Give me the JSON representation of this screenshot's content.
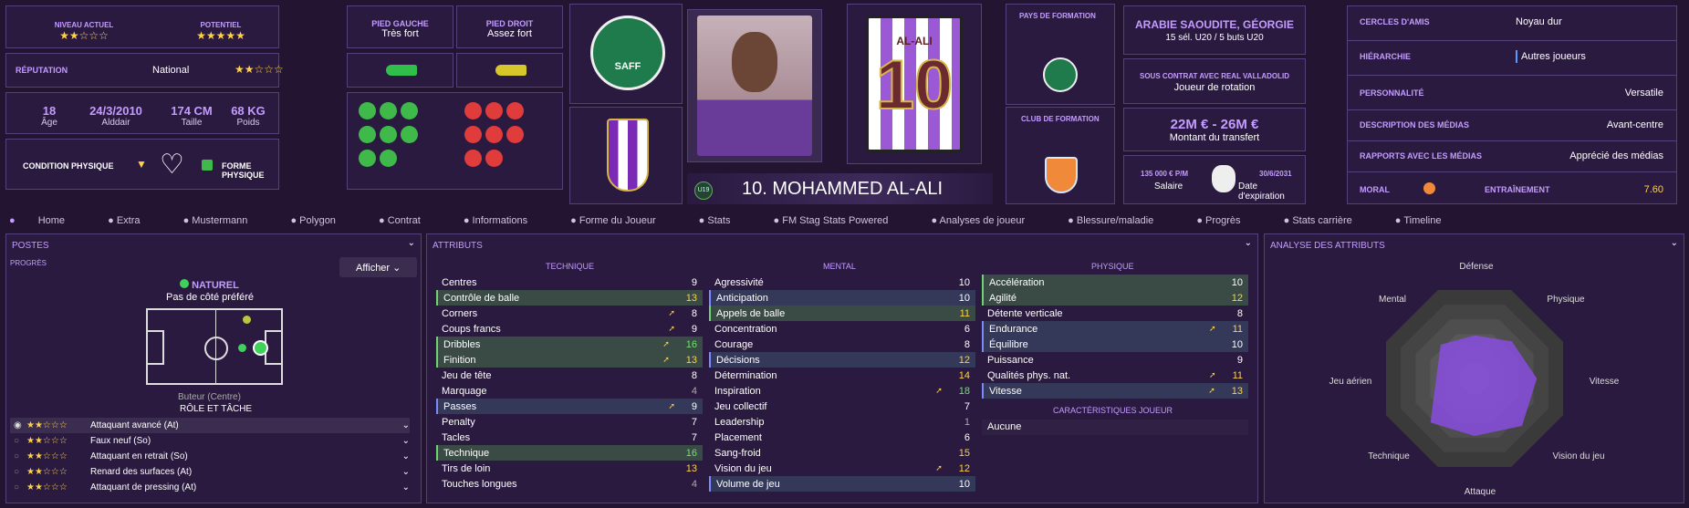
{
  "ratings": {
    "current_label": "NIVEAU ACTUEL",
    "current_stars": "★★☆☆☆",
    "potential_label": "POTENTIEL",
    "potential_stars": "★★★★★"
  },
  "reputation": {
    "label": "RÉPUTATION",
    "value": "National",
    "stars": "★★☆☆☆"
  },
  "bio": {
    "age": "18",
    "age_label": "Âge",
    "dob": "24/3/2010",
    "club_label": "Alddair",
    "height": "174 CM",
    "height_label": "Taille",
    "weight": "68 KG",
    "weight_label": "Poids"
  },
  "fitness": {
    "condition_label": "CONDITION PHYSIQUE",
    "form_label": "FORME PHYSIQUE"
  },
  "feet": {
    "left_label": "PIED GAUCHE",
    "left_value": "Très fort",
    "right_label": "PIED DROIT",
    "right_value": "Assez fort"
  },
  "formation": {
    "country_label": "PAYS DE FORMATION",
    "club_label": "CLUB DE FORMATION"
  },
  "nation": {
    "name": "ARABIE SAOUDITE, GÉORGIE",
    "caps": "15 sél. U20 / 5 buts U20"
  },
  "contract": {
    "label": "SOUS CONTRAT AVEC REAL VALLADOLID",
    "role": "Joueur de rotation",
    "value": "22M € - 26M €",
    "value_label": "Montant du transfert",
    "wage": "135 000 € P/M",
    "wage_label": "Salaire",
    "expiry": "30/6/2031",
    "expiry_label": "Date d'expiration"
  },
  "player": {
    "name": "10. MOHAMMED AL-ALI",
    "age_badge": "U19",
    "shirt_name": "AL-ALI",
    "shirt_number": "10",
    "saff": "SAFF"
  },
  "social": [
    {
      "label": "CERCLES D'AMIS",
      "value": "Noyau dur"
    },
    {
      "label": "HIÉRARCHIE",
      "value": "Autres joueurs"
    },
    {
      "label": "PERSONNALITÉ",
      "value": "Versatile"
    },
    {
      "label": "DESCRIPTION DES MÉDIAS",
      "value": "Avant-centre"
    },
    {
      "label": "RAPPORTS AVEC LES MÉDIAS",
      "value": "Apprécié des médias"
    }
  ],
  "morale": {
    "label": "MORAL",
    "training_label": "ENTRAÎNEMENT",
    "training_value": "7.60"
  },
  "tabs": [
    "Home",
    "Extra",
    "Mustermann",
    "Polygon",
    "Contrat",
    "Informations",
    "Forme du Joueur",
    "Stats",
    "FM Stag Stats Powered",
    "Analyses de joueur",
    "Blessure/maladie",
    "Progrès",
    "Stats carrière",
    "Timeline"
  ],
  "positions": {
    "title": "POSTES",
    "progress": "PROGRÈS",
    "show_button": "Afficher",
    "natural": "NATUREL",
    "side": "Pas de côté préféré",
    "role": "Buteur (Centre)",
    "role_caption": "RÔLE ET TÂCHE",
    "roles": [
      {
        "stars": "★★☆☆☆",
        "name": "Attaquant avancé (At)"
      },
      {
        "stars": "★★☆☆☆",
        "name": "Faux neuf (So)"
      },
      {
        "stars": "★★☆☆☆",
        "name": "Attaquant en retrait (So)"
      },
      {
        "stars": "★★☆☆☆",
        "name": "Renard des surfaces (At)"
      },
      {
        "stars": "★★☆☆☆",
        "name": "Attaquant de pressing (At)"
      }
    ]
  },
  "attributes": {
    "title": "ATTRIBUTS",
    "tech_title": "TECHNIQUE",
    "mental_title": "MENTAL",
    "phys_title": "PHYSIQUE",
    "traits_title": "CARACTÉRISTIQUES JOUEUR",
    "traits_value": "Aucune",
    "technique": [
      {
        "n": "Centres",
        "v": "9"
      },
      {
        "n": "Contrôle de balle",
        "v": "13"
      },
      {
        "n": "Corners",
        "v": "8"
      },
      {
        "n": "Coups francs",
        "v": "9"
      },
      {
        "n": "Dribbles",
        "v": "16"
      },
      {
        "n": "Finition",
        "v": "13"
      },
      {
        "n": "Jeu de tête",
        "v": "8"
      },
      {
        "n": "Marquage",
        "v": "4"
      },
      {
        "n": "Passes",
        "v": "9"
      },
      {
        "n": "Penalty",
        "v": "7"
      },
      {
        "n": "Tacles",
        "v": "7"
      },
      {
        "n": "Technique",
        "v": "16"
      },
      {
        "n": "Tirs de loin",
        "v": "13"
      },
      {
        "n": "Touches longues",
        "v": "4"
      }
    ],
    "mental": [
      {
        "n": "Agressivité",
        "v": "10"
      },
      {
        "n": "Anticipation",
        "v": "10"
      },
      {
        "n": "Appels de balle",
        "v": "11"
      },
      {
        "n": "Concentration",
        "v": "6"
      },
      {
        "n": "Courage",
        "v": "8"
      },
      {
        "n": "Décisions",
        "v": "12"
      },
      {
        "n": "Détermination",
        "v": "14"
      },
      {
        "n": "Inspiration",
        "v": "18"
      },
      {
        "n": "Jeu collectif",
        "v": "7"
      },
      {
        "n": "Leadership",
        "v": "1"
      },
      {
        "n": "Placement",
        "v": "6"
      },
      {
        "n": "Sang-froid",
        "v": "15"
      },
      {
        "n": "Vision du jeu",
        "v": "12"
      },
      {
        "n": "Volume de jeu",
        "v": "10"
      }
    ],
    "physique": [
      {
        "n": "Accélération",
        "v": "10"
      },
      {
        "n": "Agilité",
        "v": "12"
      },
      {
        "n": "Détente verticale",
        "v": "8"
      },
      {
        "n": "Endurance",
        "v": "11"
      },
      {
        "n": "Équilibre",
        "v": "10"
      },
      {
        "n": "Puissance",
        "v": "9"
      },
      {
        "n": "Qualités phys. nat.",
        "v": "11"
      },
      {
        "n": "Vitesse",
        "v": "13"
      }
    ]
  },
  "analysis": {
    "title": "ANALYSE DES ATTRIBUTS",
    "axes": [
      "Défense",
      "Physique",
      "Vitesse",
      "Vision du jeu",
      "Attaque",
      "Technique",
      "Jeu aérien",
      "Mental"
    ]
  },
  "colors": {
    "accent": "#c49cff",
    "bg": "#231532",
    "panel": "#2a1a40",
    "highlight_green": "#6fe46f",
    "highlight_yellow": "#ffd24a"
  }
}
